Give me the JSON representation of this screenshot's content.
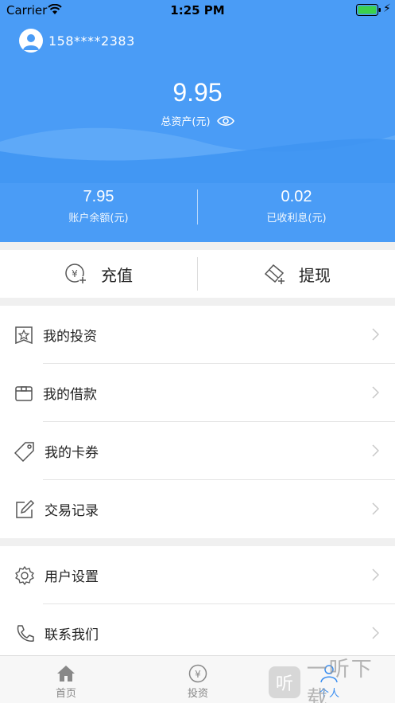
{
  "status_bar": {
    "carrier": "Carrier",
    "time": "1:25 PM"
  },
  "user": {
    "phone": "158****2383"
  },
  "assets": {
    "total_value": "9.95",
    "total_label": "总资产(元)",
    "balance_value": "7.95",
    "balance_label": "账户余额(元)",
    "interest_value": "0.02",
    "interest_label": "已收利息(元)"
  },
  "actions": {
    "recharge": "充值",
    "withdraw": "提现"
  },
  "menu": {
    "group1": [
      {
        "label": "我的投资",
        "icon": "star-badge-icon"
      },
      {
        "label": "我的借款",
        "icon": "box-icon"
      },
      {
        "label": "我的卡券",
        "icon": "tag-icon"
      },
      {
        "label": "交易记录",
        "icon": "edit-icon"
      }
    ],
    "group2": [
      {
        "label": "用户设置",
        "icon": "gear-icon"
      },
      {
        "label": "联系我们",
        "icon": "phone-icon"
      }
    ]
  },
  "tabbar": {
    "home": "首页",
    "invest": "投资",
    "me": "个人"
  },
  "watermark": {
    "text": "一听下载"
  },
  "colors": {
    "primary": "#4a9cf6",
    "tab_active": "#3a8ef0"
  }
}
